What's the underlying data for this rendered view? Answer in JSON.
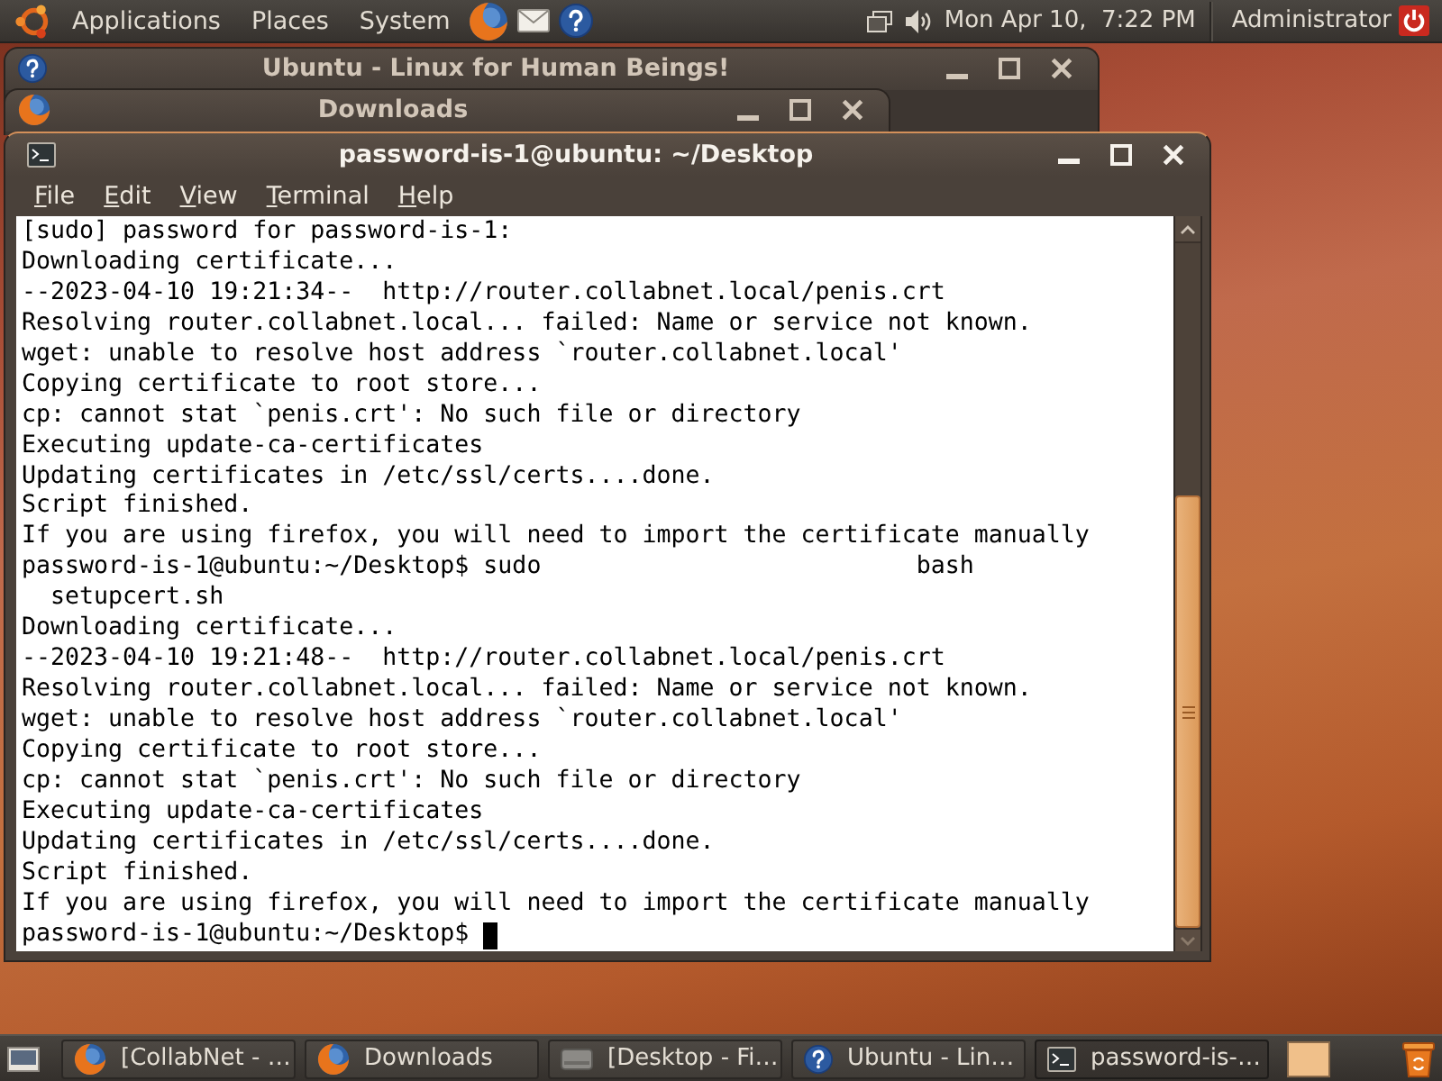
{
  "top_panel": {
    "menus": [
      "Applications",
      "Places",
      "System"
    ],
    "clock": "Mon Apr 10,  7:22 PM",
    "user": "Administrator"
  },
  "windows": [
    {
      "kind": "help",
      "title": "Ubuntu - Linux for Human Beings!",
      "active": false
    },
    {
      "kind": "browser",
      "title": "Downloads",
      "active": false
    }
  ],
  "terminal": {
    "title": "password-is-1@ubuntu: ~/Desktop",
    "active": true,
    "menu": [
      "File",
      "Edit",
      "View",
      "Terminal",
      "Help"
    ],
    "lines": [
      "[sudo] password for password-is-1:",
      "Downloading certificate...",
      "--2023-04-10 19:21:34--  http://router.collabnet.local/penis.crt",
      "Resolving router.collabnet.local... failed: Name or service not known.",
      "wget: unable to resolve host address `router.collabnet.local'",
      "Copying certificate to root store...",
      "cp: cannot stat `penis.crt': No such file or directory",
      "Executing update-ca-certificates",
      "Updating certificates in /etc/ssl/certs....done.",
      "Script finished.",
      "If you are using firefox, you will need to import the certificate manually",
      "password-is-1@ubuntu:~/Desktop$ sudo                          bash",
      "  setupcert.sh",
      "Downloading certificate...",
      "--2023-04-10 19:21:48--  http://router.collabnet.local/penis.crt",
      "Resolving router.collabnet.local... failed: Name or service not known.",
      "wget: unable to resolve host address `router.collabnet.local'",
      "Copying certificate to root store...",
      "cp: cannot stat `penis.crt': No such file or directory",
      "Executing update-ca-certificates",
      "Updating certificates in /etc/ssl/certs....done.",
      "Script finished.",
      "If you are using firefox, you will need to import the certificate manually",
      "password-is-1@ubuntu:~/Desktop$"
    ]
  },
  "taskbar": {
    "tasks": [
      {
        "kind": "browser",
        "label": "[CollabNet - …",
        "selected": false
      },
      {
        "kind": "browser",
        "label": "Downloads",
        "selected": false
      },
      {
        "kind": "files",
        "label": "[Desktop - Fi…",
        "selected": false
      },
      {
        "kind": "help",
        "label": "Ubuntu - Lin…",
        "selected": false
      },
      {
        "kind": "terminal",
        "label": "password-is-…",
        "selected": true
      }
    ]
  }
}
